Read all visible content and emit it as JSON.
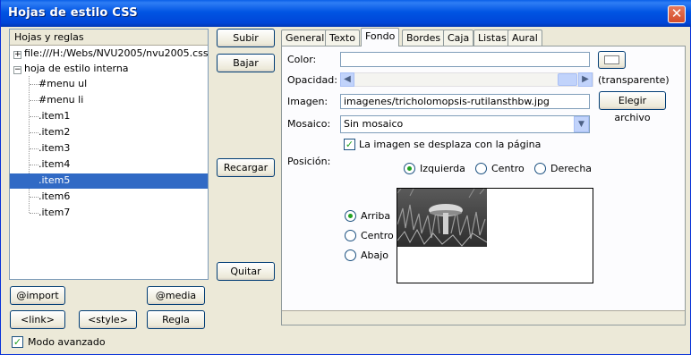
{
  "window": {
    "title": "Hojas de estilo CSS",
    "close_glyph": "✕"
  },
  "tree": {
    "header": "Hojas y reglas",
    "expander_plus": "+",
    "expander_minus": "−",
    "file_item": "file:///H:/Webs/NVU2005/nvu2005.css",
    "internal_item": "hoja de estilo interna",
    "rules": [
      "#menu ul",
      "#menu li",
      ".item1",
      ".item2",
      ".item3",
      ".item4",
      ".item5",
      ".item6",
      ".item7"
    ],
    "selected_index": 6
  },
  "left_buttons": {
    "import": "@import",
    "media": "@media",
    "link": "<link>",
    "style": "<style>",
    "regla": "Regla"
  },
  "advanced_mode": {
    "label": "Modo avanzado",
    "checked": true
  },
  "middle_buttons": {
    "subir": "Subir",
    "bajar": "Bajar",
    "recargar": "Recargar",
    "quitar": "Quitar"
  },
  "tabs": [
    "General",
    "Texto",
    "Fondo",
    "Bordes",
    "Caja",
    "Listas",
    "Aural"
  ],
  "active_tab": "Fondo",
  "fondo": {
    "color_label": "Color:",
    "color_value": "",
    "opacity_label": "Opacidad:",
    "opacity_text": "(transparente)",
    "image_label": "Imagen:",
    "image_value": "imagenes/tricholomopsis-rutilansthbw.jpg",
    "choose_file": "Elegir archivo",
    "tiling_label": "Mosaico:",
    "tiling_value": "Sin mosaico",
    "scrolls_label": "La imagen se desplaza con la página",
    "scrolls_checked": true,
    "position_label": "Posición:",
    "horizontal": [
      "Izquierda",
      "Centro",
      "Derecha"
    ],
    "horizontal_selected": "Izquierda",
    "vertical": [
      "Arriba",
      "Centro",
      "Abajo"
    ],
    "vertical_selected": "Arriba"
  },
  "colors": {
    "titlebar": "#0054e3",
    "selection": "#316ac5",
    "check": "#21a121"
  }
}
